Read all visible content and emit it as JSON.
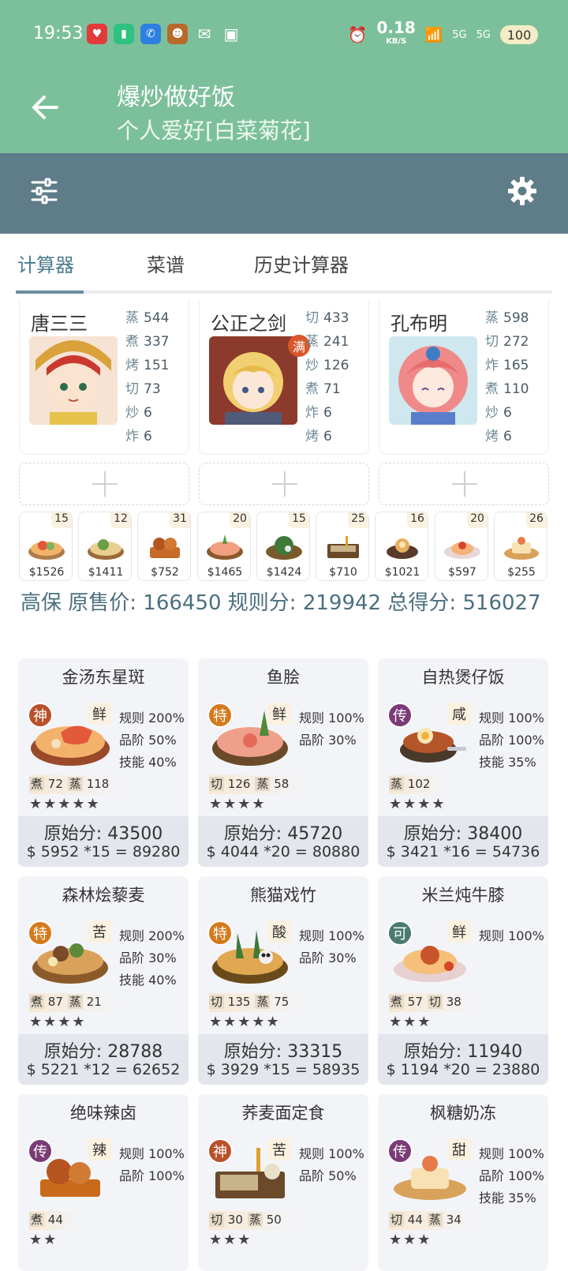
{
  "status_bar": {
    "time": "19:53",
    "net_speed": "0.18",
    "net_unit": "KB/S",
    "battery": "100",
    "signal_1": "5G",
    "signal_2": "5G"
  },
  "app_bar": {
    "title": "爆炒做好饭",
    "subtitle": "个人爱好[白菜菊花]"
  },
  "tabs": [
    "计算器",
    "菜谱",
    "历史计算器"
  ],
  "chefs": [
    {
      "name": "唐三三",
      "badge": "",
      "skills": [
        {
          "k": "蒸",
          "v": "544"
        },
        {
          "k": "煮",
          "v": "337"
        },
        {
          "k": "烤",
          "v": "151"
        },
        {
          "k": "切",
          "v": "73"
        },
        {
          "k": "炒",
          "v": "6"
        },
        {
          "k": "炸",
          "v": "6"
        }
      ]
    },
    {
      "name": "公正之剑",
      "badge": "满",
      "skills": [
        {
          "k": "切",
          "v": "433"
        },
        {
          "k": "蒸",
          "v": "241"
        },
        {
          "k": "炒",
          "v": "126"
        },
        {
          "k": "煮",
          "v": "71"
        },
        {
          "k": "炸",
          "v": "6"
        },
        {
          "k": "烤",
          "v": "6"
        }
      ]
    },
    {
      "name": "孔布明",
      "badge": "",
      "skills": [
        {
          "k": "蒸",
          "v": "598"
        },
        {
          "k": "切",
          "v": "272"
        },
        {
          "k": "炸",
          "v": "165"
        },
        {
          "k": "煮",
          "v": "110"
        },
        {
          "k": "炒",
          "v": "6"
        },
        {
          "k": "烤",
          "v": "6"
        }
      ]
    }
  ],
  "dish_strip": [
    {
      "qty": "15",
      "price": "$1526"
    },
    {
      "qty": "12",
      "price": "$1411"
    },
    {
      "qty": "31",
      "price": "$752"
    },
    {
      "qty": "20",
      "price": "$1465"
    },
    {
      "qty": "15",
      "price": "$1424"
    },
    {
      "qty": "25",
      "price": "$710"
    },
    {
      "qty": "16",
      "price": "$1021"
    },
    {
      "qty": "20",
      "price": "$597"
    },
    {
      "qty": "26",
      "price": "$255"
    }
  ],
  "summary": "高保 原售价: 166450 规则分: 219942 总得分: 516027",
  "recipes": [
    {
      "name": "金汤东星斑",
      "rank": "神",
      "rank_color": "#b8512a",
      "flavor": "鲜",
      "buffs": [
        "规则 200%",
        "品阶 50%",
        "技能 40%"
      ],
      "needs": [
        {
          "k": "煮",
          "v": "72"
        },
        {
          "k": "蒸",
          "v": "118"
        }
      ],
      "stars": "★★★★★",
      "raw": "原始分: 43500",
      "calc": "$ 5952 *15 = 89280"
    },
    {
      "name": "鱼脍",
      "rank": "特",
      "rank_color": "#d47a1e",
      "flavor": "鲜",
      "buffs": [
        "规则 100%",
        "品阶 30%"
      ],
      "needs": [
        {
          "k": "切",
          "v": "126"
        },
        {
          "k": "蒸",
          "v": "58"
        }
      ],
      "stars": "★★★★",
      "raw": "原始分: 45720",
      "calc": "$ 4044 *20 = 80880"
    },
    {
      "name": "自热煲仔饭",
      "rank": "传",
      "rank_color": "#7a3b76",
      "flavor": "咸",
      "buffs": [
        "规则 100%",
        "品阶 100%",
        "技能 35%"
      ],
      "needs": [
        {
          "k": "蒸",
          "v": "102"
        }
      ],
      "stars": "★★★★",
      "raw": "原始分: 38400",
      "calc": "$ 3421 *16 = 54736"
    },
    {
      "name": "森林烩藜麦",
      "rank": "特",
      "rank_color": "#d47a1e",
      "flavor": "苦",
      "buffs": [
        "规则 200%",
        "品阶 30%",
        "技能 40%"
      ],
      "needs": [
        {
          "k": "煮",
          "v": "87"
        },
        {
          "k": "蒸",
          "v": "21"
        }
      ],
      "stars": "★★★★",
      "raw": "原始分: 28788",
      "calc": "$ 5221 *12 = 62652"
    },
    {
      "name": "熊猫戏竹",
      "rank": "特",
      "rank_color": "#d47a1e",
      "flavor": "酸",
      "buffs": [
        "规则 100%",
        "品阶 30%"
      ],
      "needs": [
        {
          "k": "切",
          "v": "135"
        },
        {
          "k": "蒸",
          "v": "75"
        }
      ],
      "stars": "★★★★★",
      "raw": "原始分: 33315",
      "calc": "$ 3929 *15 = 58935"
    },
    {
      "name": "米兰炖牛膝",
      "rank": "可",
      "rank_color": "#4d7a70",
      "flavor": "鲜",
      "buffs": [
        "规则 100%"
      ],
      "needs": [
        {
          "k": "煮",
          "v": "57"
        },
        {
          "k": "切",
          "v": "38"
        }
      ],
      "stars": "★★★",
      "raw": "原始分: 11940",
      "calc": "$ 1194 *20 = 23880"
    },
    {
      "name": "绝味辣卤",
      "rank": "传",
      "rank_color": "#7a3b76",
      "flavor": "辣",
      "buffs": [
        "规则 100%",
        "品阶 100%"
      ],
      "needs": [
        {
          "k": "煮",
          "v": "44"
        }
      ],
      "stars": "★★",
      "raw": "",
      "calc": ""
    },
    {
      "name": "荞麦面定食",
      "rank": "神",
      "rank_color": "#b8512a",
      "flavor": "苦",
      "buffs": [
        "规则 100%",
        "品阶 50%"
      ],
      "needs": [
        {
          "k": "切",
          "v": "30"
        },
        {
          "k": "蒸",
          "v": "50"
        }
      ],
      "stars": "★★★",
      "raw": "",
      "calc": ""
    },
    {
      "name": "枫糖奶冻",
      "rank": "传",
      "rank_color": "#7a3b76",
      "flavor": "甜",
      "buffs": [
        "规则 100%",
        "品阶 100%",
        "技能 35%"
      ],
      "needs": [
        {
          "k": "切",
          "v": "44"
        },
        {
          "k": "蒸",
          "v": "34"
        }
      ],
      "stars": "★★★",
      "raw": "",
      "calc": ""
    }
  ]
}
